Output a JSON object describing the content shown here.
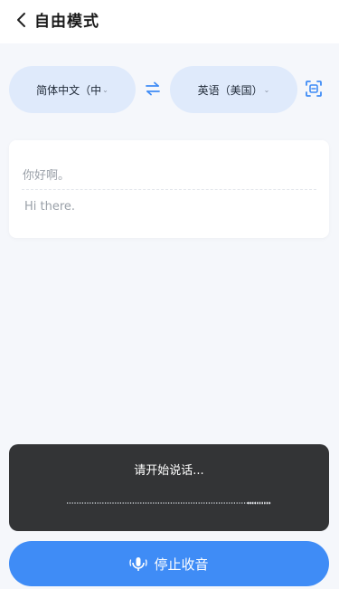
{
  "header": {
    "title": "自由模式"
  },
  "languages": {
    "source_label": "简体中文（中",
    "target_label": "英语（美国）"
  },
  "translation": {
    "source_text": "你好啊。",
    "target_text": "Hi there."
  },
  "speech_panel": {
    "prompt": "请开始说话..."
  },
  "stop_button": {
    "label": "停止收音"
  },
  "colors": {
    "accent": "#3f8cf6",
    "pill_bg": "#dfeafb",
    "panel_bg": "#333436",
    "page_bg": "#f5f7fb"
  },
  "icons": [
    "back-icon",
    "chevron-down-icon",
    "swap-icon",
    "scan-icon",
    "microphone-icon"
  ]
}
